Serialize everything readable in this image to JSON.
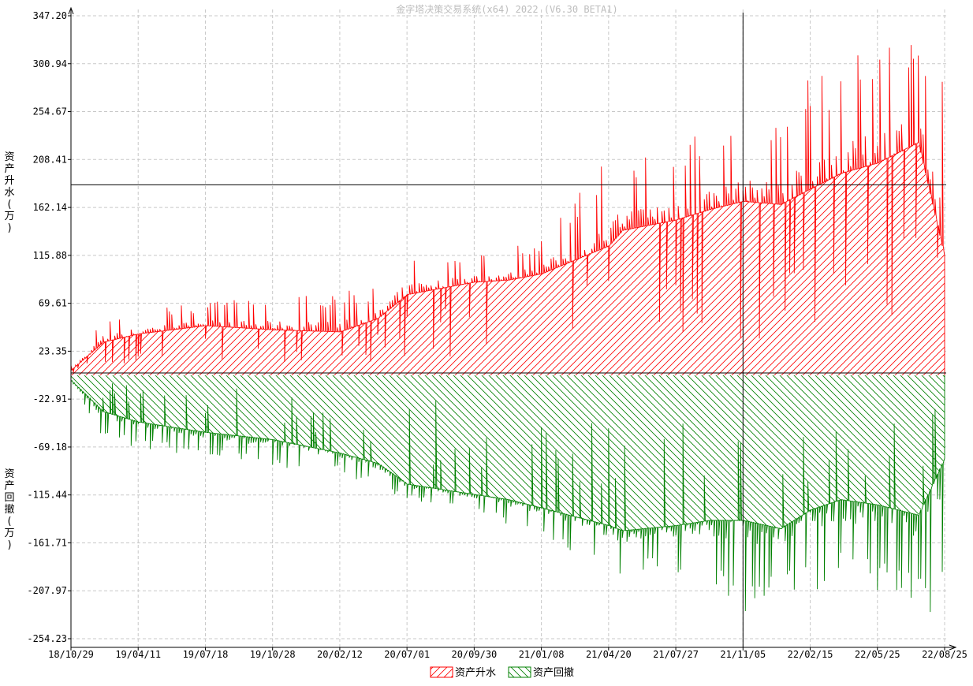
{
  "window": {
    "title": "金字塔决策交易系统(x64) 2022 (V6.30 BETA1)"
  },
  "colors": {
    "up": "#ff0000",
    "down": "#008000",
    "grid": "#c8c8c8"
  },
  "chart_data": {
    "type": "area",
    "title": "金字塔决策交易系统(x64) 2022 (V6.30 BETA1)",
    "ylabel_upper": "资产升水(万)",
    "ylabel_lower": "资产回撤(万)",
    "y_ticks": [
      "347.20",
      "300.94",
      "254.67",
      "208.41",
      "162.14",
      "115.88",
      "69.61",
      "23.35",
      "-22.91",
      "-69.18",
      "-115.44",
      "-161.71",
      "-207.97",
      "-254.23"
    ],
    "y_tick_values": [
      347.2,
      300.94,
      254.67,
      208.41,
      162.14,
      115.88,
      69.61,
      23.35,
      -22.91,
      -69.18,
      -115.44,
      -161.71,
      -207.97,
      -254.23
    ],
    "x_ticks": [
      "18/10/29",
      "19/04/11",
      "19/07/18",
      "19/10/28",
      "20/02/12",
      "20/07/01",
      "20/09/30",
      "21/01/08",
      "21/04/20",
      "21/07/27",
      "21/11/05",
      "22/02/15",
      "22/05/25",
      "22/08/25"
    ],
    "ylim": [
      -254.23,
      347.2
    ],
    "grid": true,
    "crosshair": {
      "x_date": "21/11/05",
      "y_value": 184
    },
    "legend": {
      "position": "bottom-center",
      "items": [
        {
          "label": "资产升水",
          "color": "#ff0000"
        },
        {
          "label": "资产回撤",
          "color": "#008000"
        }
      ]
    },
    "series": [
      {
        "name": "资产升水",
        "x": [
          "18/10/29",
          "19/01/15",
          "19/04/11",
          "19/07/18",
          "19/10/28",
          "20/02/12",
          "20/05/01",
          "20/07/01",
          "20/09/30",
          "20/11/20",
          "21/01/08",
          "21/04/20",
          "21/05/10",
          "21/07/27",
          "21/09/15",
          "21/11/05",
          "22/01/01",
          "22/02/15",
          "22/04/01",
          "22/05/25",
          "22/07/20",
          "22/08/25"
        ],
        "values": [
          5,
          32,
          40,
          48,
          44,
          42,
          55,
          78,
          90,
          92,
          98,
          125,
          140,
          150,
          160,
          168,
          165,
          180,
          195,
          205,
          225,
          115
        ],
        "peaks": [
          10,
          58,
          65,
          70,
          78,
          82,
          85,
          125,
          120,
          122,
          135,
          215,
          220,
          230,
          240,
          250,
          255,
          295,
          300,
          330,
          345,
          280
        ]
      },
      {
        "name": "资产回撤",
        "x": [
          "18/10/29",
          "19/01/15",
          "19/04/11",
          "19/07/18",
          "19/10/28",
          "20/02/12",
          "20/05/01",
          "20/07/01",
          "20/09/30",
          "20/11/20",
          "21/01/08",
          "21/04/20",
          "21/05/10",
          "21/07/27",
          "21/09/15",
          "21/11/05",
          "22/01/01",
          "22/02/15",
          "22/04/01",
          "22/05/25",
          "22/07/20",
          "22/08/25"
        ],
        "values": [
          -5,
          -35,
          -45,
          -55,
          -62,
          -75,
          -85,
          -105,
          -115,
          -120,
          -128,
          -145,
          -150,
          -145,
          -140,
          -140,
          -148,
          -130,
          -120,
          -125,
          -135,
          -80
        ],
        "troughs": [
          -10,
          -62,
          -70,
          -80,
          -90,
          -95,
          -110,
          -120,
          -130,
          -145,
          -155,
          -190,
          -195,
          -190,
          -200,
          -230,
          -210,
          -210,
          -205,
          -215,
          -225,
          -250
        ]
      }
    ]
  }
}
